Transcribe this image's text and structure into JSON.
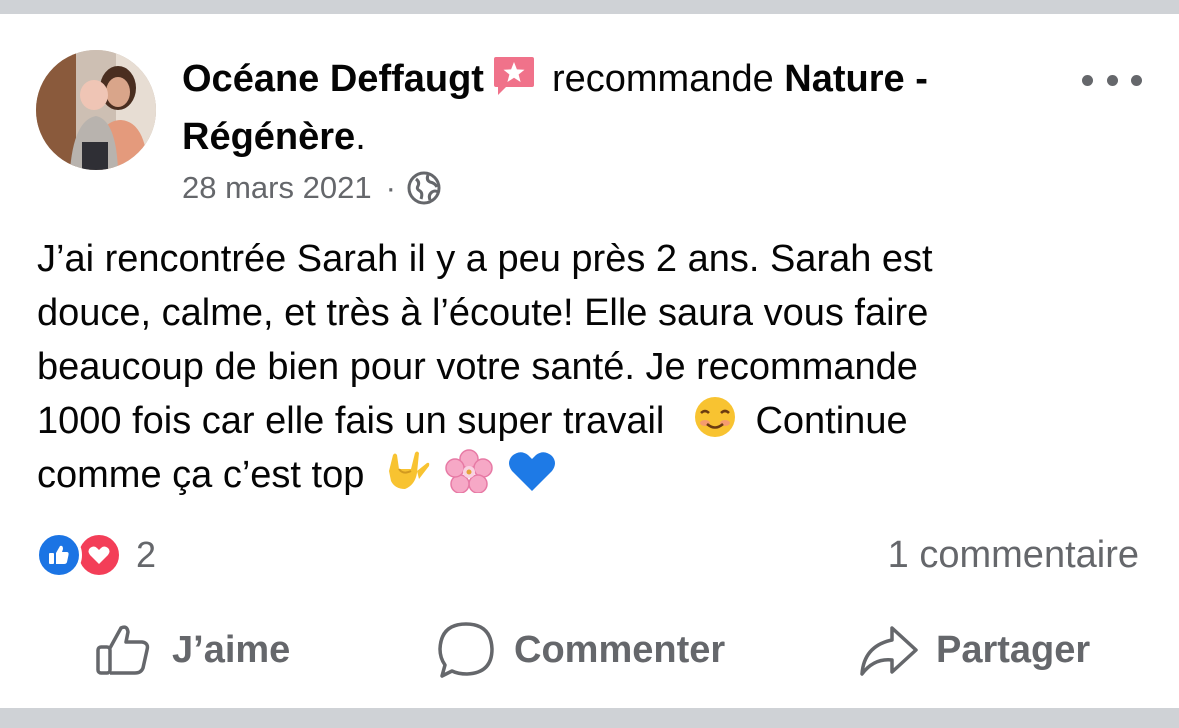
{
  "header": {
    "author": "Océane Deffaugt",
    "verb": "recommande",
    "page_name": "Nature - Régénère",
    "period": "."
  },
  "meta": {
    "date": "28 mars 2021",
    "separator": "·",
    "audience_icon": "globe-icon"
  },
  "post": {
    "line1": "J’ai rencontrée Sarah il y a peu près 2 ans. Sarah est",
    "line2": "douce, calme, et très à l’écoute! Elle saura vous faire",
    "line3": "beaucoup de bien pour votre santé. Je recommande",
    "line4a": "1000 fois car elle fais un super travail",
    "line4b": "Continue",
    "line5": "comme ça c’est top",
    "emojis": [
      "smiling-face-emoji",
      "love-you-hand-emoji",
      "cherry-blossom-emoji",
      "blue-heart-emoji"
    ]
  },
  "stats": {
    "reaction_count": "2",
    "comments": "1 commentaire",
    "reaction_icons": [
      "like-icon",
      "love-icon"
    ]
  },
  "actions": {
    "like": "J’aime",
    "comment": "Commenter",
    "share": "Partager"
  },
  "colors": {
    "like_blue": "#1b74e4",
    "love_red": "#f33e58",
    "secondary_text": "#65676b",
    "recommend_badge": "#f0728a"
  }
}
